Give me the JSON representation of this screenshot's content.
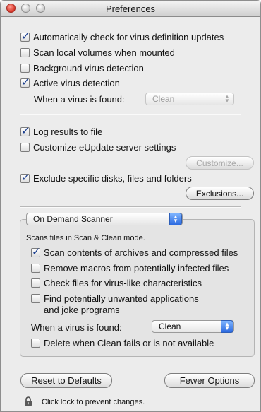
{
  "window": {
    "title": "Preferences"
  },
  "general": {
    "auto_check_updates": {
      "label": "Automatically check for virus definition updates",
      "checked": true
    },
    "scan_local_volumes": {
      "label": "Scan local volumes when mounted",
      "checked": false
    },
    "background_detection": {
      "label": "Background virus detection",
      "checked": false
    },
    "active_detection": {
      "label": "Active virus detection",
      "checked": true
    },
    "found_label": "When a virus is found:",
    "found_value": "Clean"
  },
  "logging": {
    "log_results": {
      "label": "Log results to file",
      "checked": true
    },
    "customize_eupdate": {
      "label": "Customize eUpdate server settings",
      "checked": false
    },
    "customize_button": "Customize...",
    "exclude": {
      "label": "Exclude specific disks, files and folders",
      "checked": true
    },
    "exclusions_button": "Exclusions..."
  },
  "scanner": {
    "selected": "On Demand Scanner",
    "mode_text": "Scans files in Scan & Clean mode.",
    "scan_archives": {
      "label": "Scan contents of archives and compressed files",
      "checked": true
    },
    "remove_macros": {
      "label": "Remove macros from potentially infected files",
      "checked": false
    },
    "virus_like": {
      "label": "Check files for virus-like characteristics",
      "checked": false
    },
    "unwanted_apps": {
      "label_line1": "Find potentially unwanted applications",
      "label_line2": "and joke programs",
      "checked": false
    },
    "found_label": "When a virus is found:",
    "found_value": "Clean",
    "delete_when_fails": {
      "label": "Delete when Clean fails or is not available",
      "checked": false
    }
  },
  "footer": {
    "reset_button": "Reset to Defaults",
    "fewer_button": "Fewer Options",
    "lock_text": "Click lock to prevent changes."
  }
}
